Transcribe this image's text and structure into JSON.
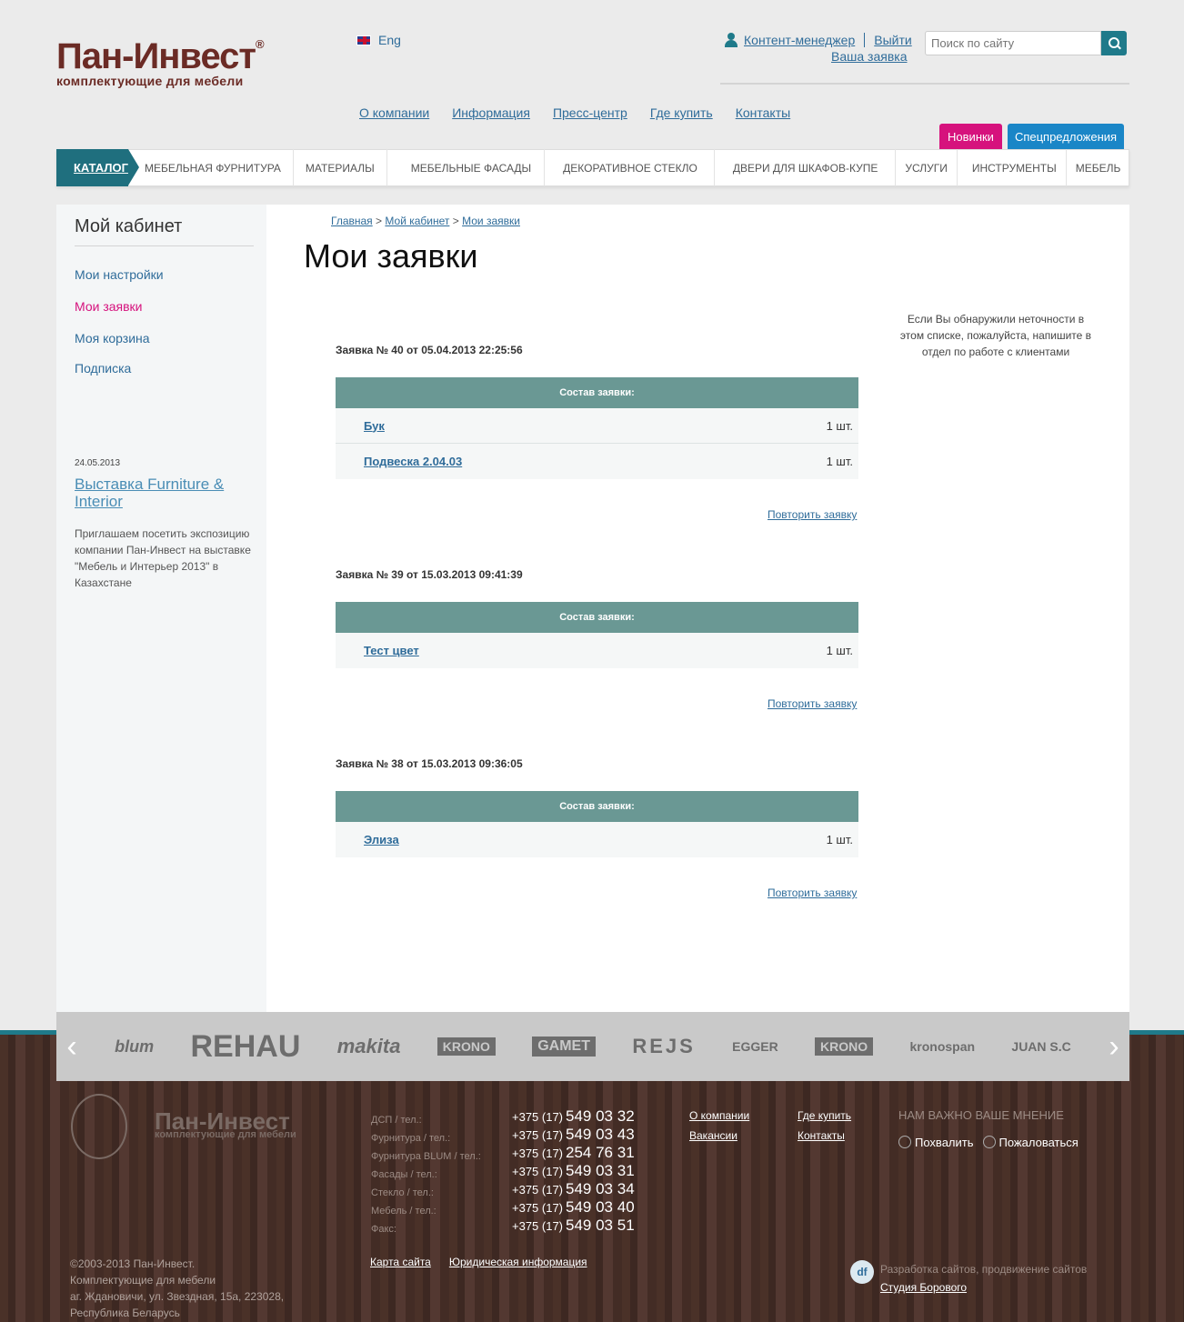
{
  "header": {
    "logo_main": "Пан-Инвест",
    "logo_reg": "®",
    "logo_sub": "комплектующие для мебели",
    "lang": "Eng",
    "user_name": "Контент-менеджер",
    "logout": "Выйти",
    "my_order": "Ваша заявка",
    "search_placeholder": "Поиск по сайту",
    "nav": [
      "О компании",
      "Информация",
      "Пресс-центр",
      "Где купить",
      "Контакты"
    ],
    "tab_new": "Новинки",
    "tab_special": "Спецпредложения"
  },
  "catalog": {
    "button": "КАТАЛОГ",
    "items": [
      "МЕБЕЛЬНАЯ ФУРНИТУРА",
      "МАТЕРИАЛЫ",
      "МЕБЕЛЬНЫЕ ФАСАДЫ",
      "ДЕКОРАТИВНОЕ СТЕКЛО",
      "ДВЕРИ ДЛЯ ШКАФОВ-КУПЕ",
      "УСЛУГИ",
      "ИНСТРУМЕНТЫ",
      "МЕБЕЛЬ"
    ]
  },
  "sidebar": {
    "title": "Мой кабинет",
    "links": [
      "Мои настройки",
      "Мои заявки",
      "Моя корзина",
      "Подписка"
    ],
    "news_date": "24.05.2013",
    "news_title": "Выставка Furniture & Interior",
    "news_text": "Приглашаем посетить экспозицию компании Пан-Инвест на выставке \"Мебель и Интерьер 2013\" в Казахстане"
  },
  "breadcrumb": {
    "home": "Главная",
    "sep": ">",
    "cabinet": "Мой кабинет",
    "current": "Мои заявки"
  },
  "page_title": "Мои заявки",
  "notice": "Если Вы обнаружили неточности в этом списке, пожалуйста, напишите в отдел по работе с клиентами",
  "orders_head": "Состав заявки:",
  "repeat_label": "Повторить заявку",
  "orders": [
    {
      "title": "Заявка № 40 от 05.04.2013 22:25:56",
      "items": [
        {
          "name": "Бук",
          "qty": "1 шт."
        },
        {
          "name": "Подвеска 2.04.03",
          "qty": "1 шт."
        }
      ]
    },
    {
      "title": "Заявка № 39 от 15.03.2013 09:41:39",
      "items": [
        {
          "name": "Тест цвет",
          "qty": "1 шт."
        }
      ]
    },
    {
      "title": "Заявка № 38 от 15.03.2013 09:36:05",
      "items": [
        {
          "name": "Элиза",
          "qty": "1 шт."
        }
      ]
    }
  ],
  "brands": [
    "blum",
    "REHAU",
    "makita",
    "KRONO",
    "GAMET",
    "REJS",
    "EGGER",
    "KRONO",
    "kronospan",
    "JUAN S.C"
  ],
  "footer": {
    "logo_main": "Пан-Инвест",
    "logo_sub": "комплектующие для мебели",
    "phones": [
      {
        "label": "ДСП / тел.:",
        "code": "+375 (17)",
        "num": "549 03 32"
      },
      {
        "label": "Фурнитура / тел.:",
        "code": "+375 (17)",
        "num": "549 03 43"
      },
      {
        "label": "Фурнитура BLUM / тел.:",
        "code": "+375 (17)",
        "num": "254 76 31"
      },
      {
        "label": "Фасады / тел.:",
        "code": "+375 (17)",
        "num": "549 03 31"
      },
      {
        "label": "Стекло / тел.:",
        "code": "+375 (17)",
        "num": "549 03 34"
      },
      {
        "label": "Мебель / тел.:",
        "code": "+375 (17)",
        "num": "549 03 40"
      },
      {
        "label": "Факс:",
        "code": "+375 (17)",
        "num": "549 03 51"
      }
    ],
    "links_col1": [
      "О компании",
      "Вакансии"
    ],
    "links_col2": [
      "Где купить",
      "Контакты"
    ],
    "opinion": "НАМ ВАЖНО ВАШЕ МНЕНИЕ",
    "praise": "Похвалить",
    "complain": "Пожаловаться",
    "copyright": [
      "©2003-2013 Пан-Инвест.",
      "Комплектующие для мебели",
      "аг. Ждановичи, ул. Звездная, 15а, 223028,",
      "Республика Беларусь"
    ],
    "sitemap": "Карта сайта",
    "legal": "Юридическая информация",
    "dev_text": "Разработка сайтов, продвижение сайтов",
    "dev_link": "Студия Борового",
    "dev_logo": "df"
  }
}
